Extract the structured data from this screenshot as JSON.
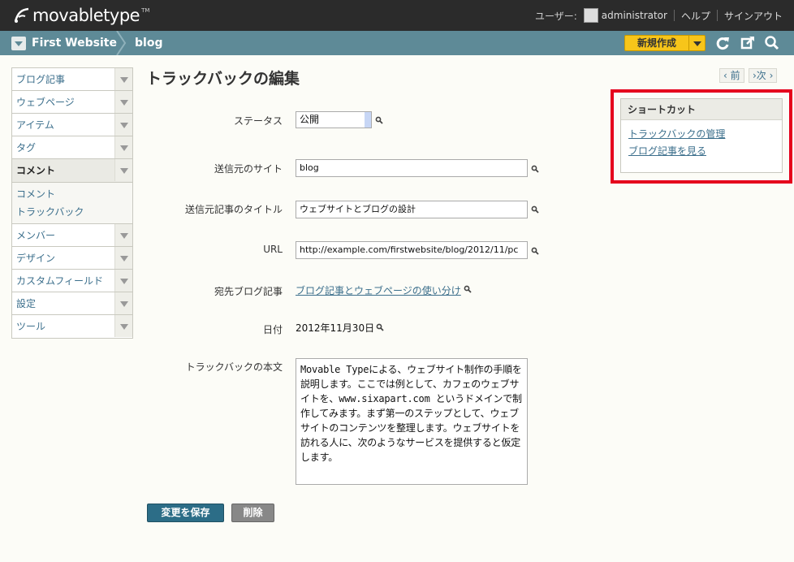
{
  "header": {
    "logo_text": "movabletype",
    "logo_tm": "TM",
    "user_label": "ユーザー:",
    "username": "administrator",
    "help": "ヘルプ",
    "signout": "サインアウト"
  },
  "context": {
    "site": "First Website",
    "blog": "blog",
    "new_button": "新規作成"
  },
  "sidebar": {
    "items": [
      {
        "label": "ブログ記事"
      },
      {
        "label": "ウェブページ"
      },
      {
        "label": "アイテム"
      },
      {
        "label": "タグ"
      },
      {
        "label": "コメント"
      },
      {
        "label": "メンバー"
      },
      {
        "label": "デザイン"
      },
      {
        "label": "カスタムフィールド"
      },
      {
        "label": "設定"
      },
      {
        "label": "ツール"
      }
    ],
    "sub_items": [
      {
        "label": "コメント"
      },
      {
        "label": "トラックバック"
      }
    ]
  },
  "main": {
    "title": "トラックバックの編集",
    "prev": "‹ 前",
    "next": "›次 ›",
    "fields": {
      "status_label": "ステータス",
      "status_value": "公開",
      "source_site_label": "送信元のサイト",
      "source_site_value": "blog",
      "source_title_label": "送信元記事のタイトル",
      "source_title_value": "ウェブサイトとブログの設計",
      "url_label": "URL",
      "url_value": "http://example.com/firstwebsite/blog/2012/11/pc",
      "target_label": "宛先ブログ記事",
      "target_value": "ブログ記事とウェブページの使い分け",
      "date_label": "日付",
      "date_value": "2012年11月30日",
      "body_label": "トラックバックの本文",
      "body_value": "Movable Typeによる、ウェブサイト制作の手順を説明します。ここでは例として、カフェのウェブサイトを、www.sixapart.com というドメインで制作してみます。まず第一のステップとして、ウェブサイトのコンテンツを整理します。ウェブサイトを訪れる人に、次のようなサービスを提供すると仮定します。"
    },
    "save_button": "変更を保存",
    "delete_button": "削除"
  },
  "shortcut": {
    "title": "ショートカット",
    "links": [
      {
        "label": "トラックバックの管理"
      },
      {
        "label": "ブログ記事を見る"
      }
    ]
  },
  "colors": {
    "topbar": "#2b2b2b",
    "context_bar": "#5e8a97",
    "accent_yellow": "#f7c51a",
    "link": "#3c6f8c",
    "save_button": "#2c6d87",
    "highlight": "#e5001c"
  }
}
